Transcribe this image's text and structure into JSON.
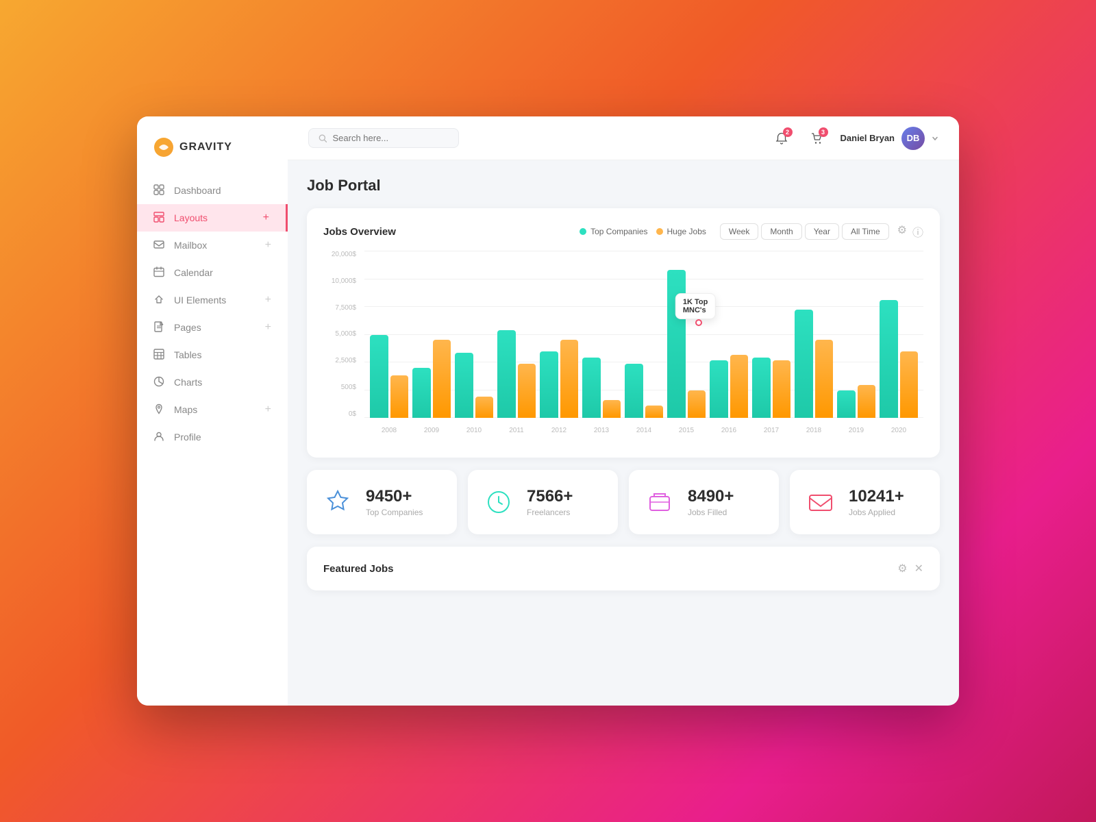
{
  "app": {
    "name": "GRAVITY"
  },
  "header": {
    "search_placeholder": "Search here...",
    "user_name": "Daniel Bryan",
    "bell_badge": "2",
    "cart_badge": "3"
  },
  "sidebar": {
    "items": [
      {
        "id": "dashboard",
        "label": "Dashboard",
        "icon": "dashboard-icon",
        "active": false,
        "has_plus": false
      },
      {
        "id": "layouts",
        "label": "Layouts",
        "icon": "layout-icon",
        "active": true,
        "has_plus": true
      },
      {
        "id": "mailbox",
        "label": "Mailbox",
        "icon": "mailbox-icon",
        "active": false,
        "has_plus": true
      },
      {
        "id": "calendar",
        "label": "Calendar",
        "icon": "calendar-icon",
        "active": false,
        "has_plus": false
      },
      {
        "id": "ui-elements",
        "label": "UI Elements",
        "icon": "ui-icon",
        "active": false,
        "has_plus": true
      },
      {
        "id": "pages",
        "label": "Pages",
        "icon": "pages-icon",
        "active": false,
        "has_plus": true
      },
      {
        "id": "tables",
        "label": "Tables",
        "icon": "tables-icon",
        "active": false,
        "has_plus": false
      },
      {
        "id": "charts",
        "label": "Charts",
        "icon": "charts-icon",
        "active": false,
        "has_plus": false
      },
      {
        "id": "maps",
        "label": "Maps",
        "icon": "maps-icon",
        "active": false,
        "has_plus": true
      },
      {
        "id": "profile",
        "label": "Profile",
        "icon": "profile-icon",
        "active": false,
        "has_plus": false
      }
    ]
  },
  "page": {
    "title": "Job Portal"
  },
  "jobs_overview": {
    "title": "Jobs Overview",
    "legend": [
      {
        "label": "Top Companies",
        "color": "#2de0c0"
      },
      {
        "label": "Huge Jobs",
        "color": "#ffb64d"
      }
    ],
    "time_filters": [
      "Week",
      "Month",
      "Year",
      "All Time"
    ],
    "tooltip": "1K Top\nMNC's",
    "y_labels": [
      "20,000$",
      "10,000$",
      "7,500$",
      "5,000$",
      "2,500$",
      "500$",
      "0$"
    ],
    "bars": [
      {
        "year": "2008",
        "teal": 55,
        "orange": 28
      },
      {
        "year": "2009",
        "teal": 33,
        "orange": 52
      },
      {
        "year": "2010",
        "teal": 43,
        "orange": 14
      },
      {
        "year": "2011",
        "teal": 58,
        "orange": 36
      },
      {
        "year": "2012",
        "teal": 44,
        "orange": 52
      },
      {
        "year": "2013",
        "teal": 40,
        "orange": 12
      },
      {
        "year": "2014",
        "teal": 36,
        "orange": 8
      },
      {
        "year": "2015",
        "teal": 98,
        "orange": 18
      },
      {
        "year": "2016",
        "teal": 38,
        "orange": 42
      },
      {
        "year": "2017",
        "teal": 40,
        "orange": 38
      },
      {
        "year": "2018",
        "teal": 72,
        "orange": 52
      },
      {
        "year": "2019",
        "teal": 18,
        "orange": 22
      },
      {
        "year": "2020",
        "teal": 78,
        "orange": 44
      }
    ]
  },
  "stats": [
    {
      "value": "9450+",
      "label": "Top Companies",
      "icon": "star-icon",
      "color": "#4a90d9"
    },
    {
      "value": "7566+",
      "label": "Freelancers",
      "icon": "clock-icon",
      "color": "#2de0c0"
    },
    {
      "value": "8490+",
      "label": "Jobs Filled",
      "icon": "inbox-icon",
      "color": "#e060e0"
    },
    {
      "value": "10241+",
      "label": "Jobs Applied",
      "icon": "mail-icon",
      "color": "#f04e6e"
    }
  ],
  "featured": {
    "title": "Featured Jobs"
  }
}
